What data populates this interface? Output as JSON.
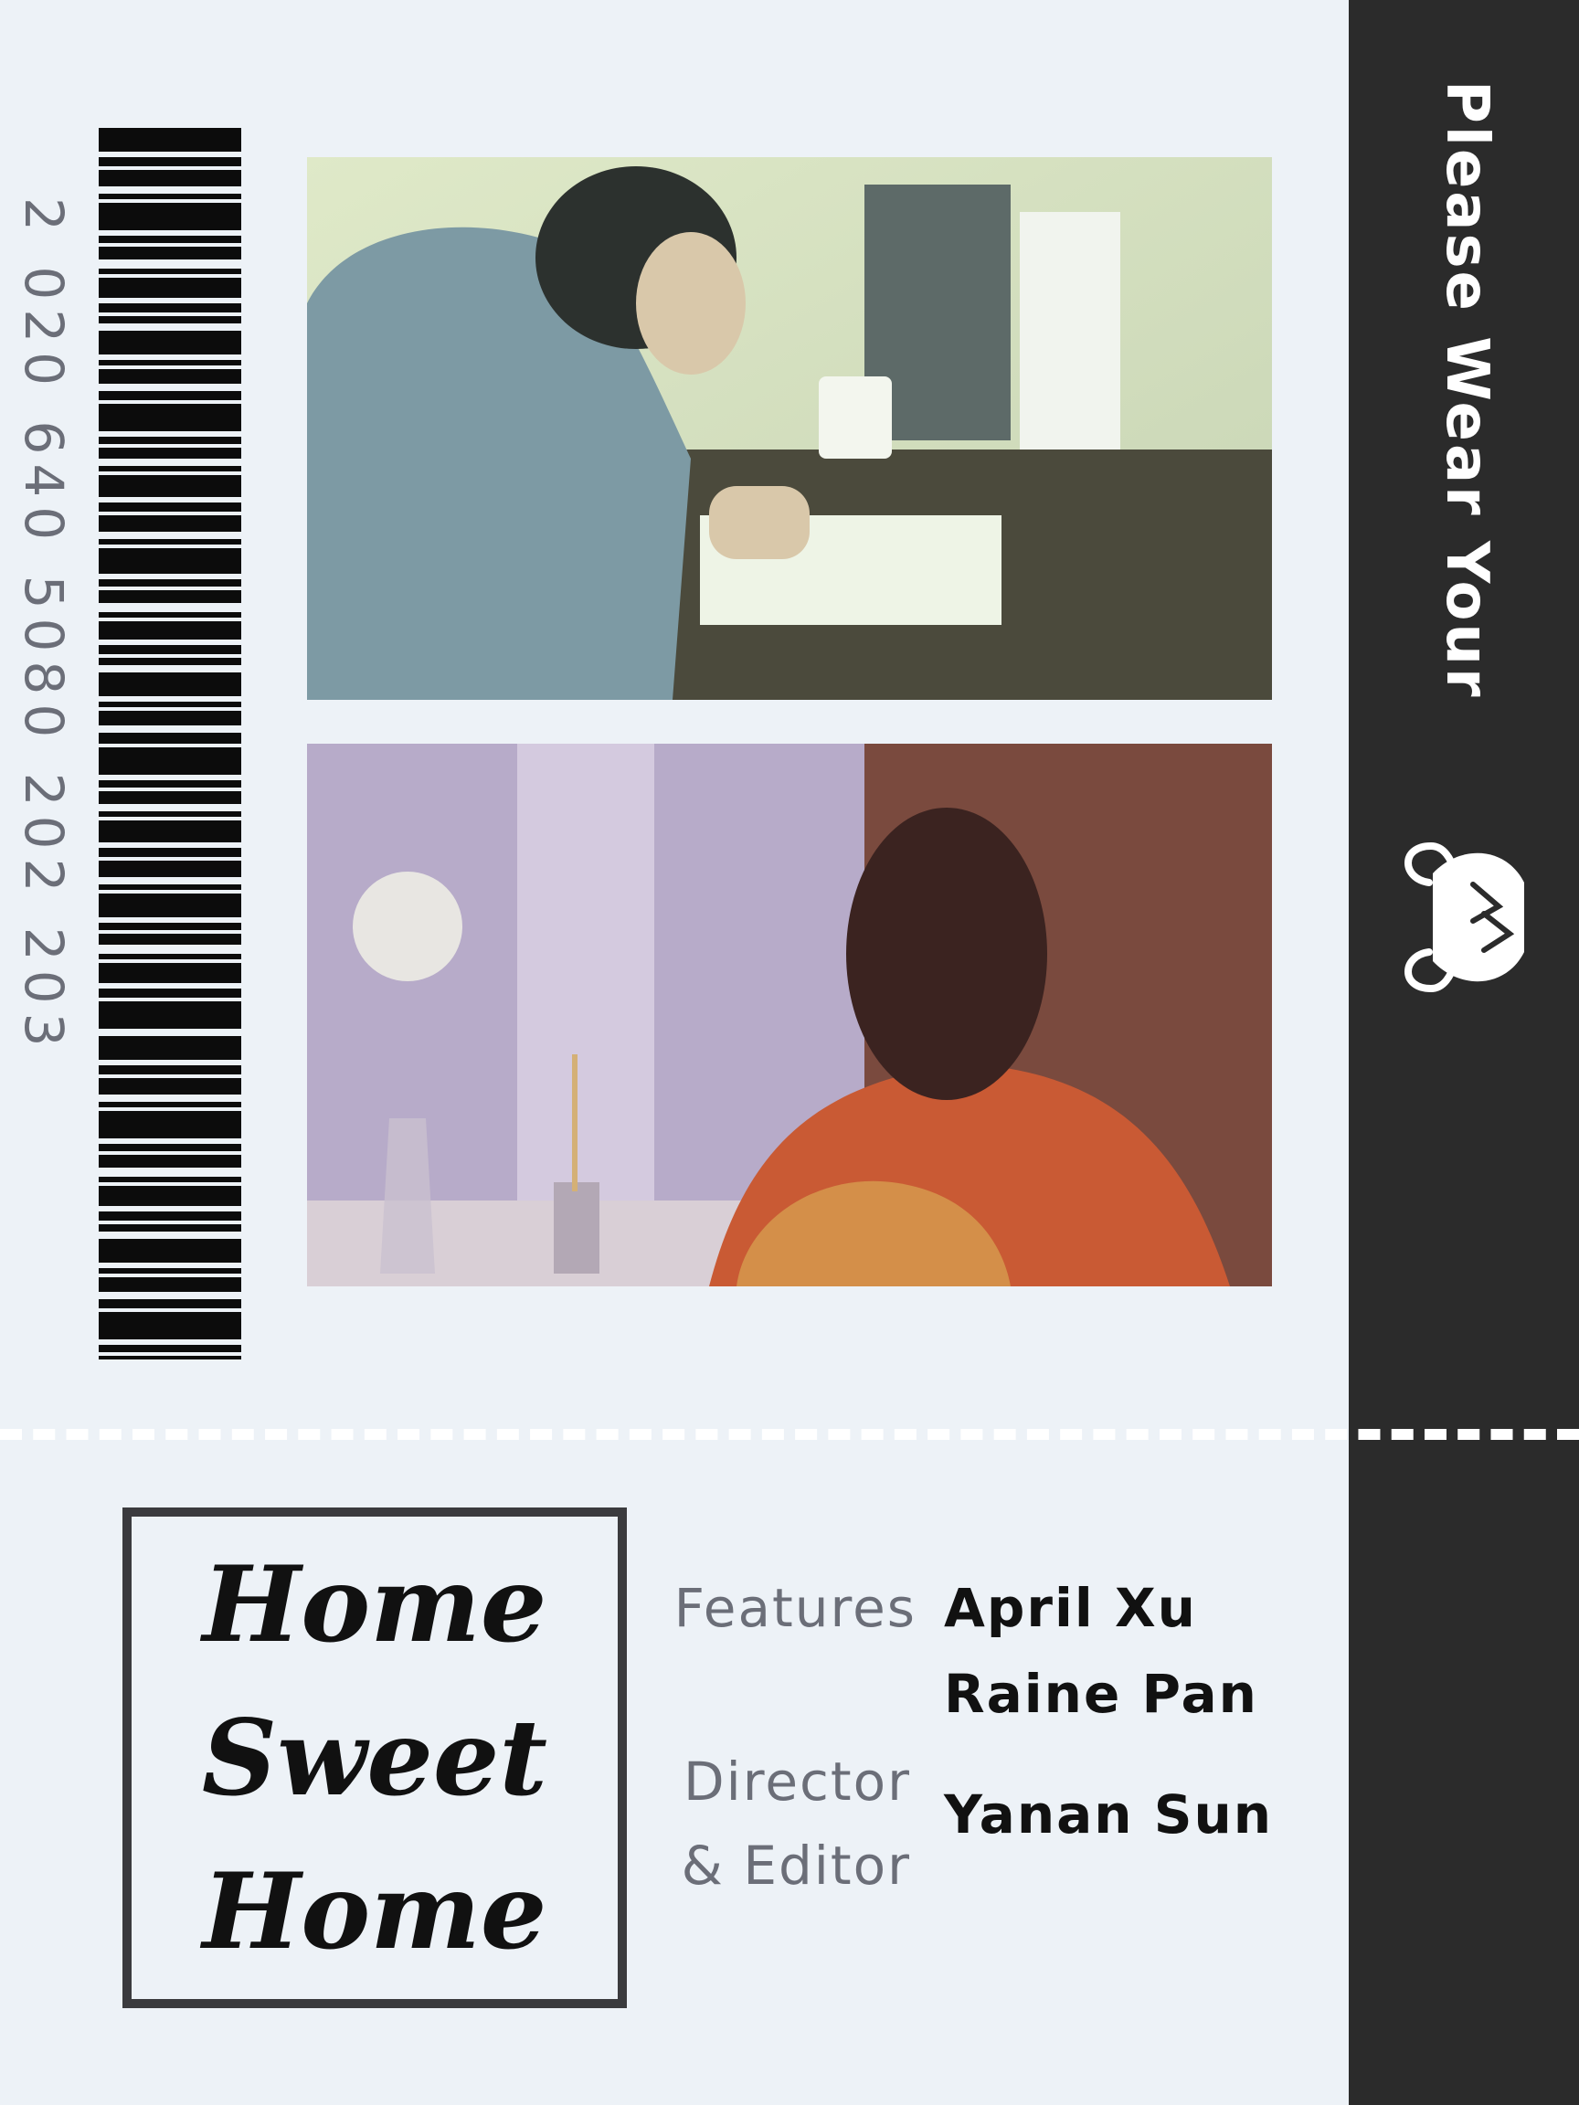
{
  "side_banner": {
    "text": "Please Wear Your",
    "icon": "face-mask-icon"
  },
  "barcode": {
    "digits": "2 020 640 5080 202 203"
  },
  "photos": [
    {
      "subject": "woman-writing-calligraphy"
    },
    {
      "subject": "woman-at-window-with-flowers"
    }
  ],
  "title": {
    "lines": [
      "Home",
      "Sweet",
      "Home"
    ]
  },
  "credits": {
    "features_label": "Features",
    "features_names": [
      "April Xu",
      "Raine Pan"
    ],
    "director_label_line1": "Director",
    "director_label_line2": "& Editor",
    "director_name": "Yanan Sun"
  },
  "colors": {
    "background": "#edf2f7",
    "band": "#2b2b2b",
    "label_gray": "#6b6e78",
    "text": "#111111"
  }
}
